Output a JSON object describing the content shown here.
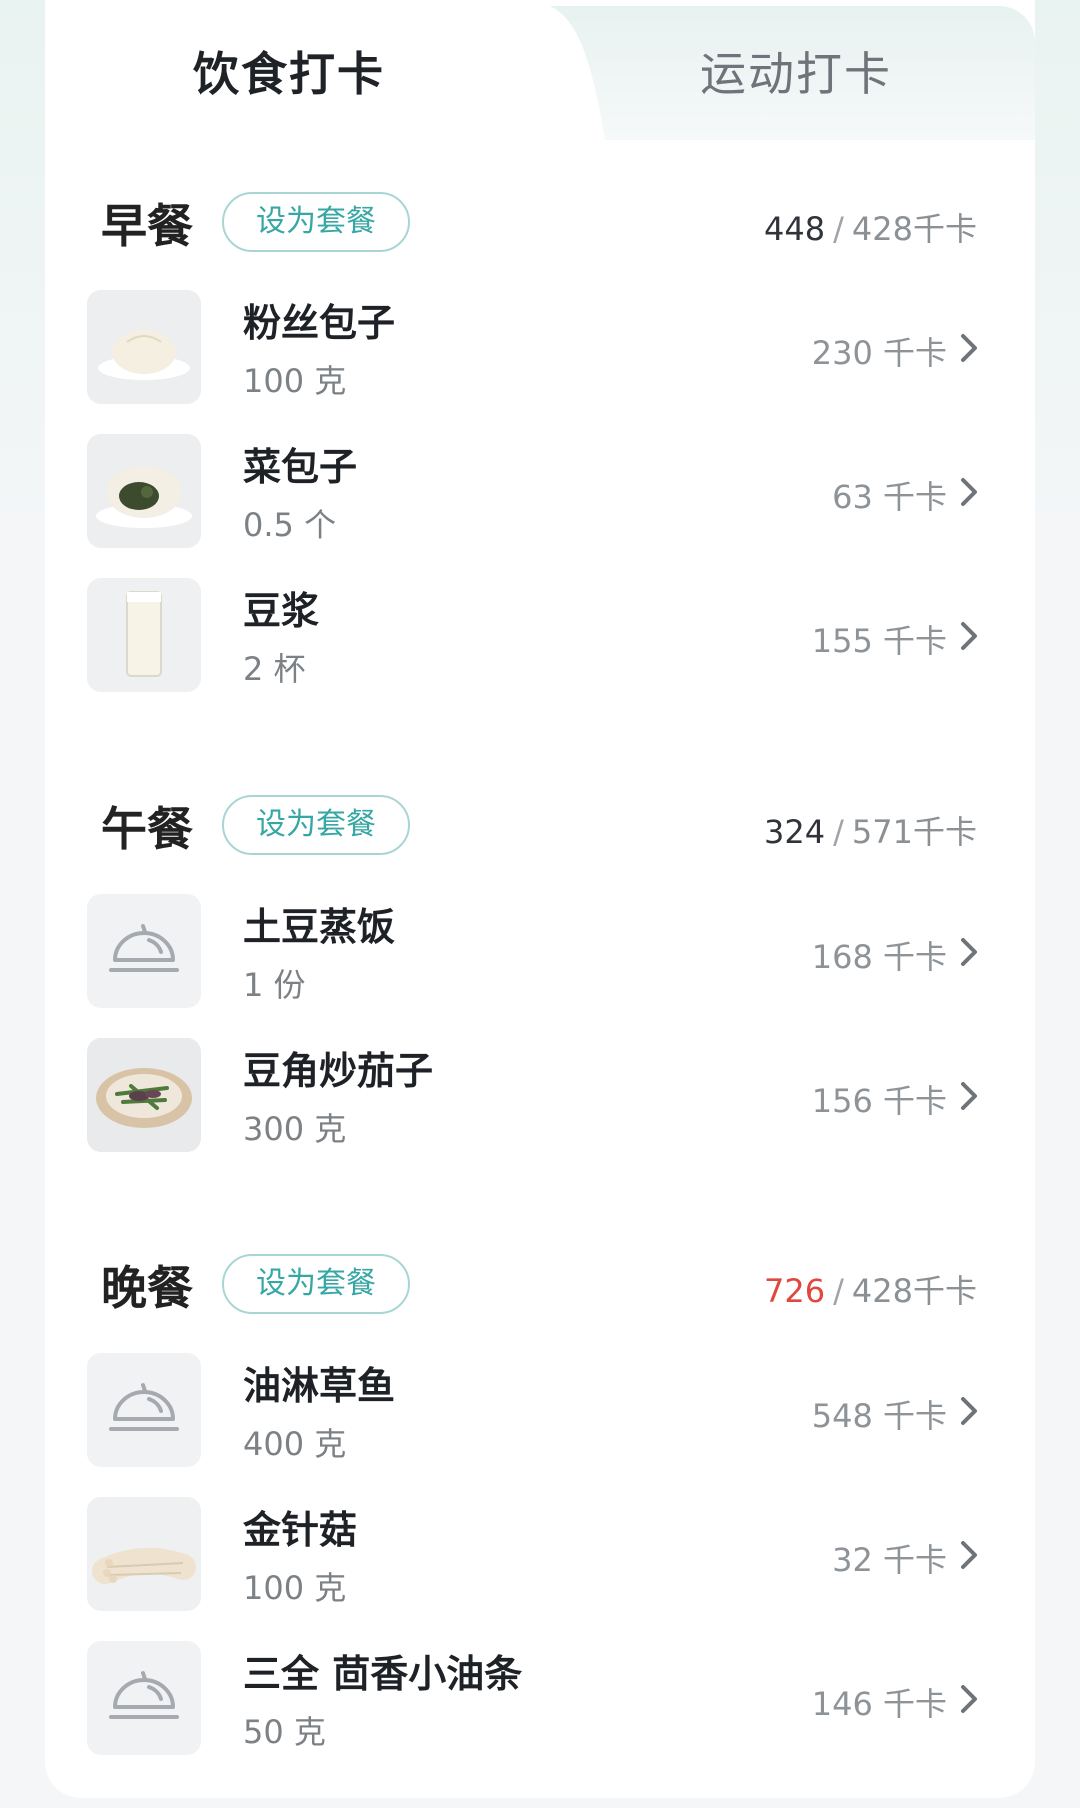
{
  "tabs": {
    "diet": "饮食打卡",
    "exercise": "运动打卡"
  },
  "set_combo_label": "设为套餐",
  "kcal_unit": "千卡",
  "colors": {
    "accent": "#36a7a4",
    "over_limit": "#e0483f"
  },
  "sections": [
    {
      "title": "早餐",
      "consumed": "448",
      "target": "428千卡",
      "items": [
        {
          "name": "粉丝包子",
          "qty": "100 克",
          "kcal": "230 千卡",
          "icon": "steamed-bun-photo"
        },
        {
          "name": "菜包子",
          "qty": "0.5 个",
          "kcal": "63 千卡",
          "icon": "vegetable-bun-photo"
        },
        {
          "name": "豆浆",
          "qty": "2 杯",
          "kcal": "155 千卡",
          "icon": "soy-milk-photo"
        }
      ]
    },
    {
      "title": "午餐",
      "consumed": "324",
      "target": "571千卡",
      "items": [
        {
          "name": "土豆蒸饭",
          "qty": "1 份",
          "kcal": "168 千卡",
          "icon": "food-cloche-icon"
        },
        {
          "name": "豆角炒茄子",
          "qty": "300 克",
          "kcal": "156 千卡",
          "icon": "beans-eggplant-photo"
        }
      ]
    },
    {
      "title": "晚餐",
      "consumed": "726",
      "target": "428千卡",
      "items": [
        {
          "name": "油淋草鱼",
          "qty": "400 克",
          "kcal": "548 千卡",
          "icon": "food-cloche-icon"
        },
        {
          "name": "金针菇",
          "qty": "100 克",
          "kcal": "32 千卡",
          "icon": "enoki-mushroom-photo"
        },
        {
          "name": "三全 茴香小油条",
          "qty": "50 克",
          "kcal": "146 千卡",
          "icon": "food-cloche-icon"
        }
      ]
    }
  ]
}
